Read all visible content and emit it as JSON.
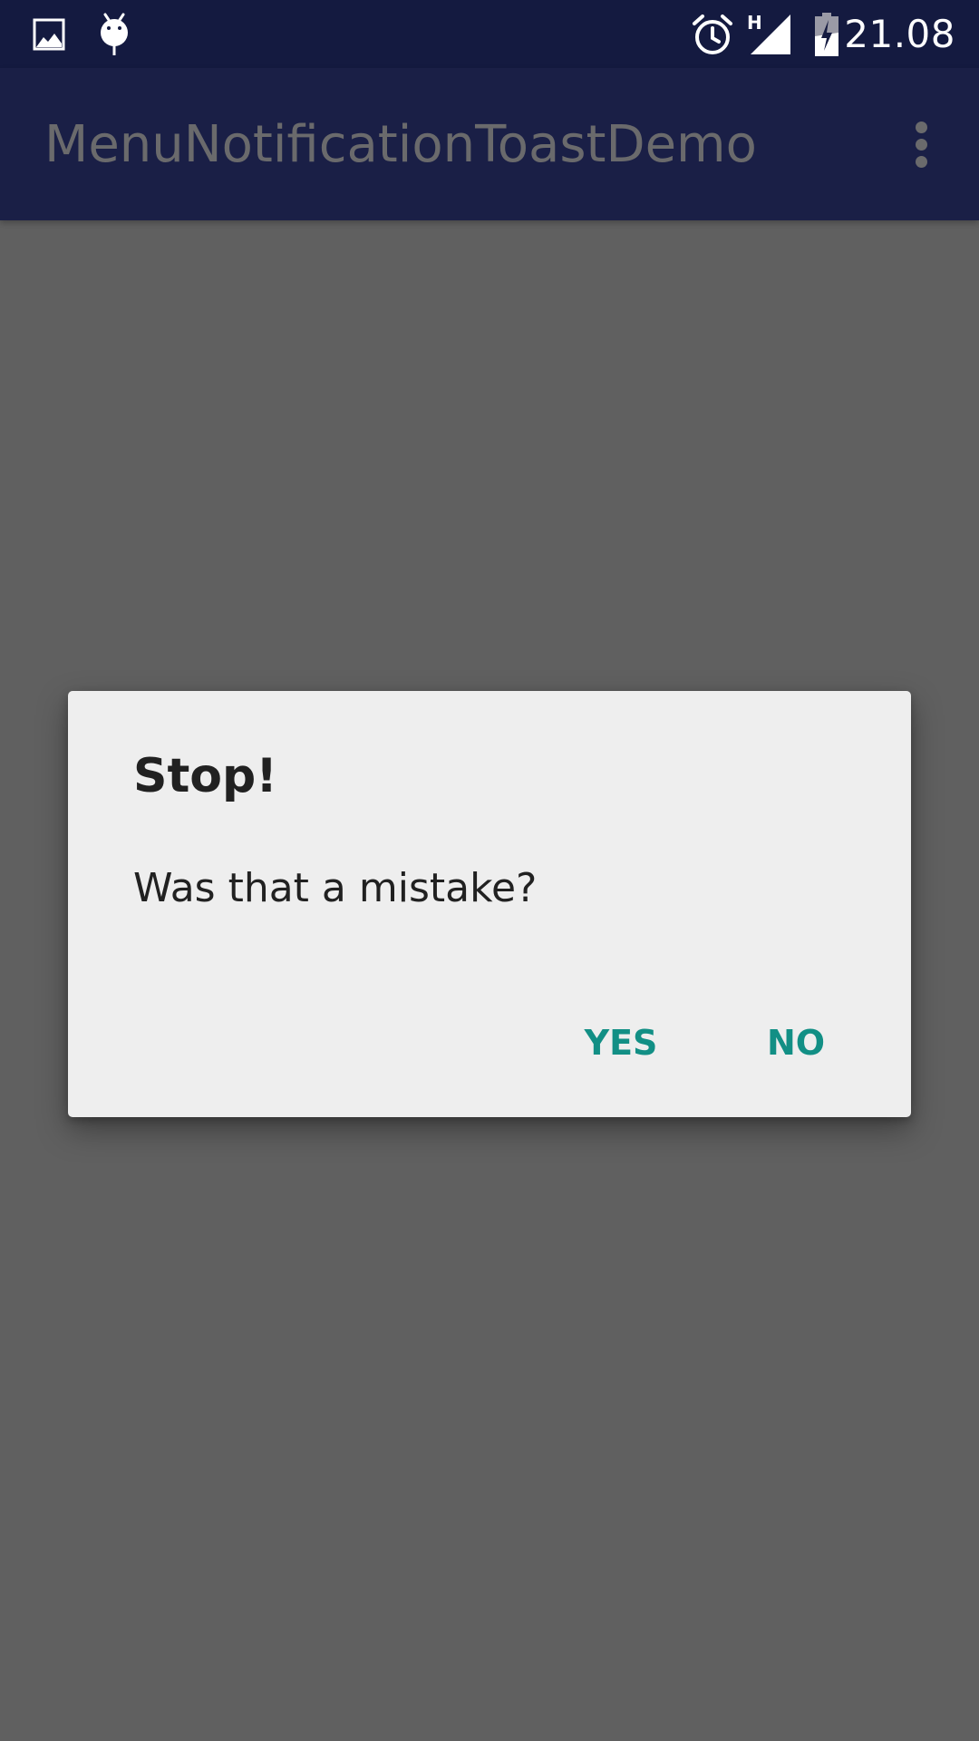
{
  "status_bar": {
    "time": "21.08",
    "network_type": "H",
    "icons": [
      "image-notification-icon",
      "android-debug-icon",
      "alarm-icon",
      "signal-icon",
      "battery-charging-icon"
    ]
  },
  "app_bar": {
    "title": "MenuNotificationToastDemo",
    "overflow_icon": "more-vert-icon"
  },
  "dialog": {
    "title": "Stop!",
    "message": "Was that a mistake?",
    "positive_label": "YES",
    "negative_label": "NO"
  },
  "colors": {
    "status_bar": "#141a40",
    "app_bar_dimmed": "#1a1f46",
    "scrim_background": "#606060",
    "dialog_background": "#eeeeee",
    "accent": "#128f85",
    "text_primary": "#212121"
  }
}
